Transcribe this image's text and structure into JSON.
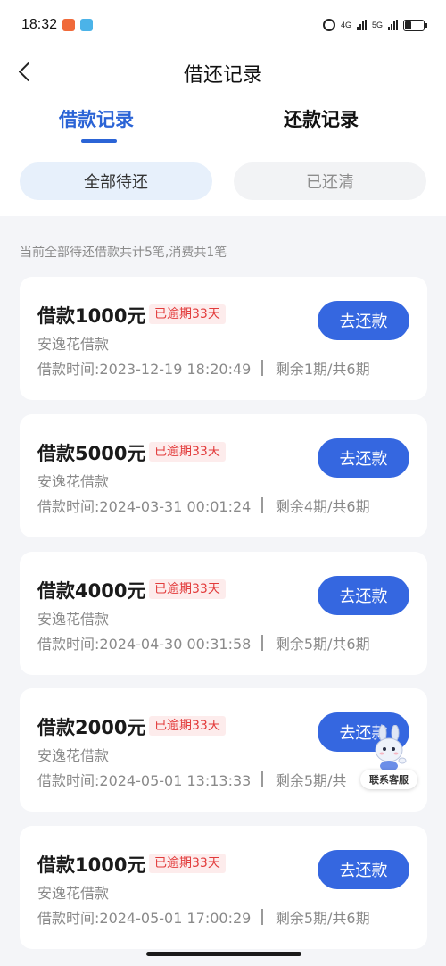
{
  "status_bar": {
    "time": "18:32",
    "net1": "4G",
    "net2": "5G"
  },
  "header": {
    "title": "借还记录"
  },
  "tabs": [
    {
      "label": "借款记录",
      "active": true
    },
    {
      "label": "还款记录",
      "active": false
    }
  ],
  "filters": [
    {
      "label": "全部待还",
      "active": true
    },
    {
      "label": "已还清",
      "active": false
    }
  ],
  "summary": "当前全部待还借款共计5笔,消费共1笔",
  "loans": [
    {
      "amount": "借款1000元",
      "badge": "已逾期33天",
      "product": "安逸花借款",
      "time": "借款时间:2023-12-19 18:20:49",
      "term": "剩余1期/共6期",
      "button": "去还款"
    },
    {
      "amount": "借款5000元",
      "badge": "已逾期33天",
      "product": "安逸花借款",
      "time": "借款时间:2024-03-31 00:01:24",
      "term": "剩余4期/共6期",
      "button": "去还款"
    },
    {
      "amount": "借款4000元",
      "badge": "已逾期33天",
      "product": "安逸花借款",
      "time": "借款时间:2024-04-30 00:31:58",
      "term": "剩余5期/共6期",
      "button": "去还款"
    },
    {
      "amount": "借款2000元",
      "badge": "已逾期33天",
      "product": "安逸花借款",
      "time": "借款时间:2024-05-01 13:13:33",
      "term": "剩余5期/共",
      "button": "去还款"
    },
    {
      "amount": "借款1000元",
      "badge": "已逾期33天",
      "product": "安逸花借款",
      "time": "借款时间:2024-05-01 17:00:29",
      "term": "剩余5期/共6期",
      "button": "去还款"
    }
  ],
  "customer_service": {
    "label": "联系客服"
  },
  "colors": {
    "accent": "#3567e0",
    "tab_active": "#2b64d6",
    "overdue": "#e23c3c",
    "overdue_bg": "#fdecec"
  }
}
